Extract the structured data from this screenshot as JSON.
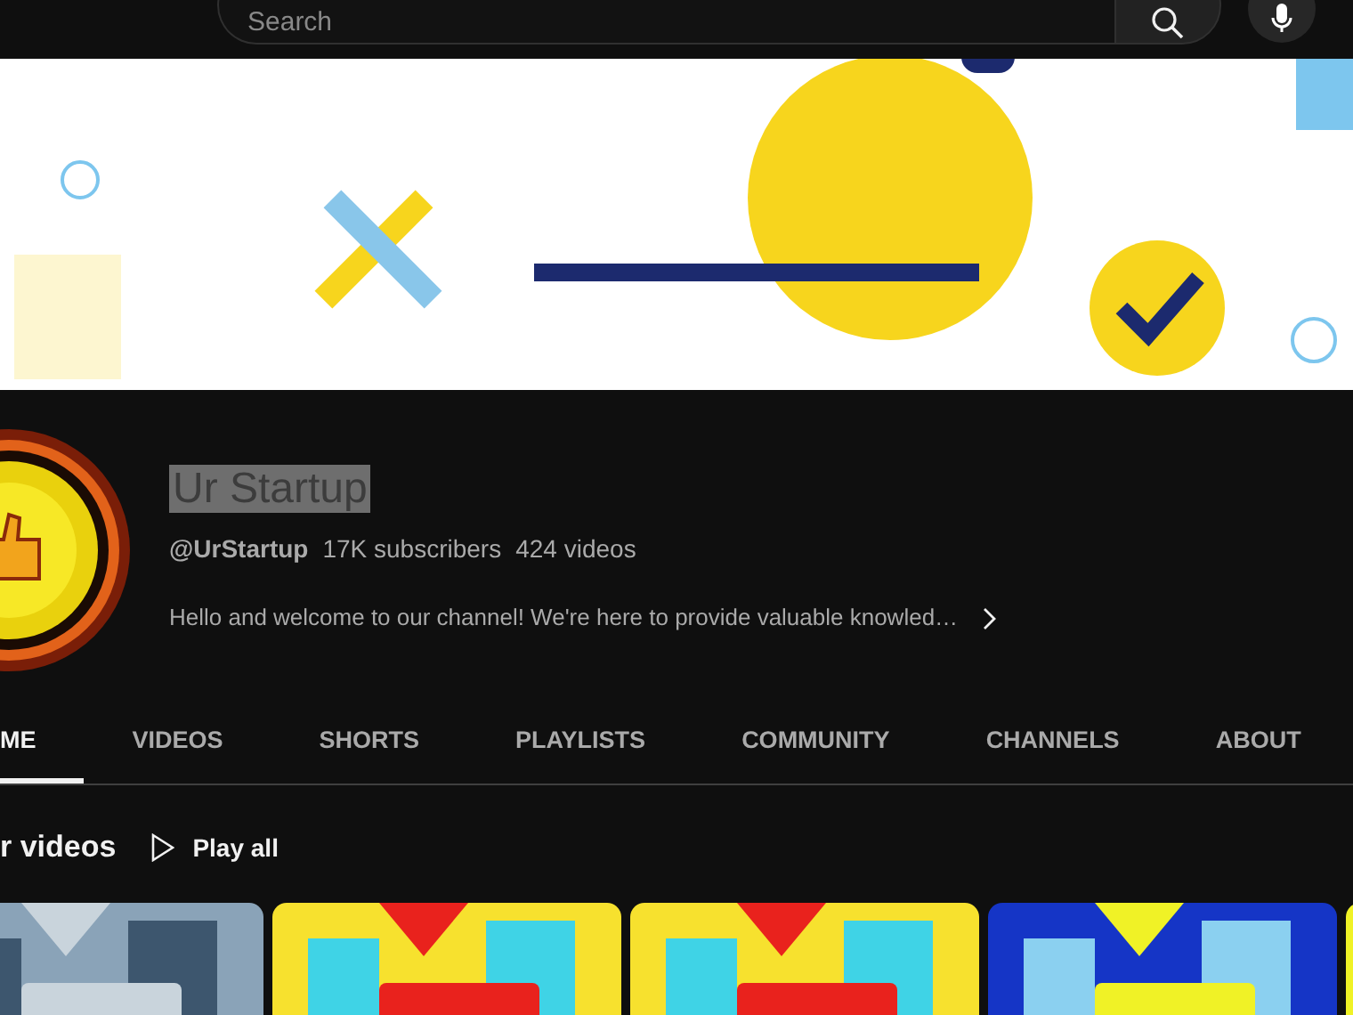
{
  "topbar": {
    "search": {
      "placeholder": "Search"
    }
  },
  "channel": {
    "name": "Ur Startup",
    "name_text_selected": true,
    "handle": "@UrStartup",
    "subscribers": "17K subscribers",
    "videos": "424 videos",
    "description": "Hello and welcome to our channel! We're here to provide valuable knowled…"
  },
  "tabs": [
    {
      "label": "ME",
      "selected": true
    },
    {
      "label": "VIDEOS",
      "selected": false
    },
    {
      "label": "SHORTS",
      "selected": false
    },
    {
      "label": "PLAYLISTS",
      "selected": false
    },
    {
      "label": "COMMUNITY",
      "selected": false
    },
    {
      "label": "CHANNELS",
      "selected": false
    },
    {
      "label": "ABOUT",
      "selected": false
    }
  ],
  "section": {
    "title": "r videos",
    "play_all": "Play all"
  }
}
